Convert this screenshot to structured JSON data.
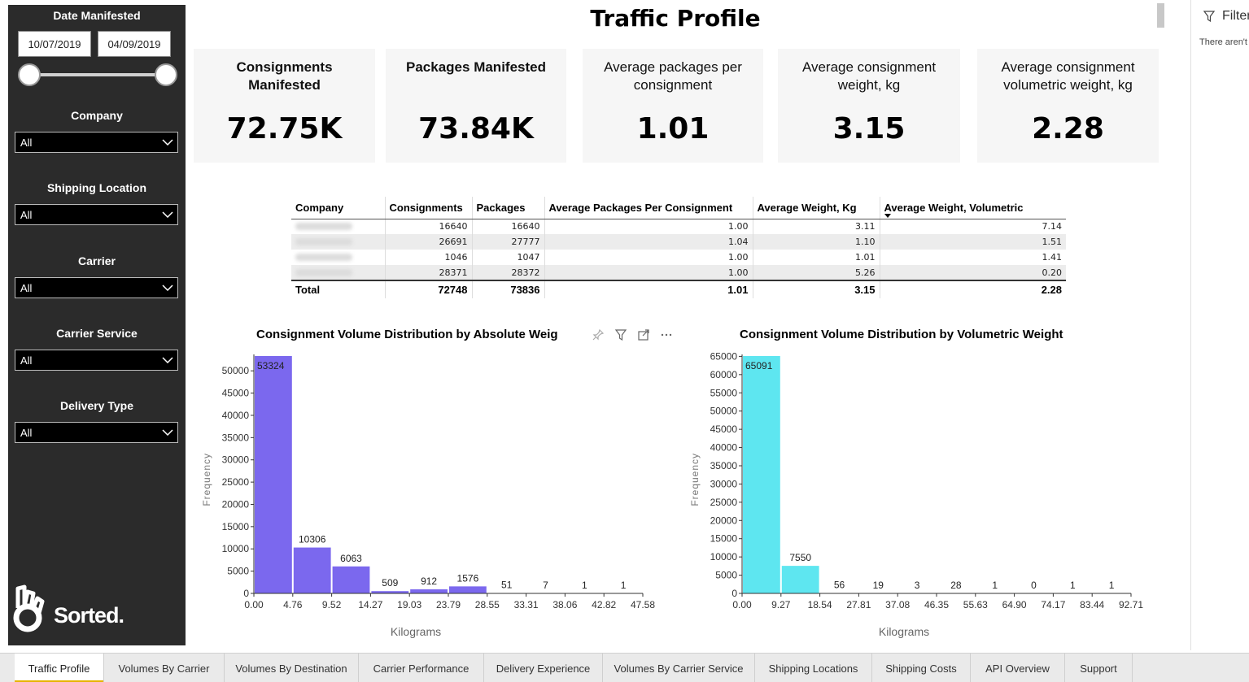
{
  "page_title": "Traffic Profile",
  "filters": {
    "date_label": "Date Manifested",
    "date_from": "10/07/2019",
    "date_to": "04/09/2019",
    "company_label": "Company",
    "company_value": "All",
    "shipping_location_label": "Shipping Location",
    "shipping_location_value": "All",
    "carrier_label": "Carrier",
    "carrier_value": "All",
    "carrier_service_label": "Carrier Service",
    "carrier_service_value": "All",
    "delivery_type_label": "Delivery Type",
    "delivery_type_value": "All",
    "logo_text": "Sorted."
  },
  "kpis": [
    {
      "label": "Consignments Manifested",
      "value": "72.75K"
    },
    {
      "label": "Packages Manifested",
      "value": "73.84K"
    },
    {
      "label": "Average packages per consignment",
      "value": "1.01"
    },
    {
      "label": "Average consignment weight, kg",
      "value": "3.15"
    },
    {
      "label": "Average consignment volumetric weight, kg",
      "value": "2.28"
    }
  ],
  "table": {
    "headers": [
      "Company",
      "Consignments",
      "Packages",
      "Average Packages Per Consignment",
      "Average Weight, Kg",
      "Average Weight, Volumetric"
    ],
    "rows": [
      [
        "16640",
        "16640",
        "1.00",
        "3.11",
        "7.14"
      ],
      [
        "26691",
        "27777",
        "1.04",
        "1.10",
        "1.51"
      ],
      [
        "1046",
        "1047",
        "1.00",
        "1.01",
        "1.41"
      ],
      [
        "28371",
        "28372",
        "1.00",
        "5.26",
        "0.20"
      ]
    ],
    "total": [
      "Total",
      "72748",
      "73836",
      "1.01",
      "3.15",
      "2.28"
    ]
  },
  "chart_data": [
    {
      "type": "bar",
      "title": "Consignment Volume Distribution by Absolute Weig",
      "xlabel": "Kilograms",
      "ylabel": "Frequency",
      "x_ticks": [
        "0.00",
        "4.76",
        "9.52",
        "14.27",
        "19.03",
        "23.79",
        "28.55",
        "33.31",
        "38.06",
        "42.82",
        "47.58"
      ],
      "values": [
        53324,
        10306,
        6063,
        509,
        912,
        1576,
        51,
        7,
        1,
        1
      ],
      "ylim": [
        0,
        53324
      ],
      "y_ticks": [
        0,
        5000,
        10000,
        15000,
        20000,
        25000,
        30000,
        35000,
        40000,
        45000,
        50000
      ],
      "color": "#7b68ee"
    },
    {
      "type": "bar",
      "title": "Consignment Volume Distribution by Volumetric Weight",
      "xlabel": "Kilograms",
      "ylabel": "Frequency",
      "x_ticks": [
        "0.00",
        "9.27",
        "18.54",
        "27.81",
        "37.08",
        "46.35",
        "55.63",
        "64.90",
        "74.17",
        "83.44",
        "92.71"
      ],
      "values": [
        65091,
        7550,
        56,
        19,
        3,
        28,
        1,
        0,
        1,
        1
      ],
      "ylim": [
        0,
        65091
      ],
      "y_ticks": [
        0,
        5000,
        10000,
        15000,
        20000,
        25000,
        30000,
        35000,
        40000,
        45000,
        50000,
        55000,
        60000,
        65000
      ],
      "color": "#5ee6f0"
    }
  ],
  "filter_pane": {
    "title": "Filter",
    "message": "There aren't"
  },
  "tabs": [
    "Traffic Profile",
    "Volumes By Carrier",
    "Volumes By Destination",
    "Carrier Performance",
    "Delivery Experience",
    "Volumes By Carrier Service",
    "Shipping Locations",
    "Shipping Costs",
    "API Overview",
    "Support"
  ]
}
